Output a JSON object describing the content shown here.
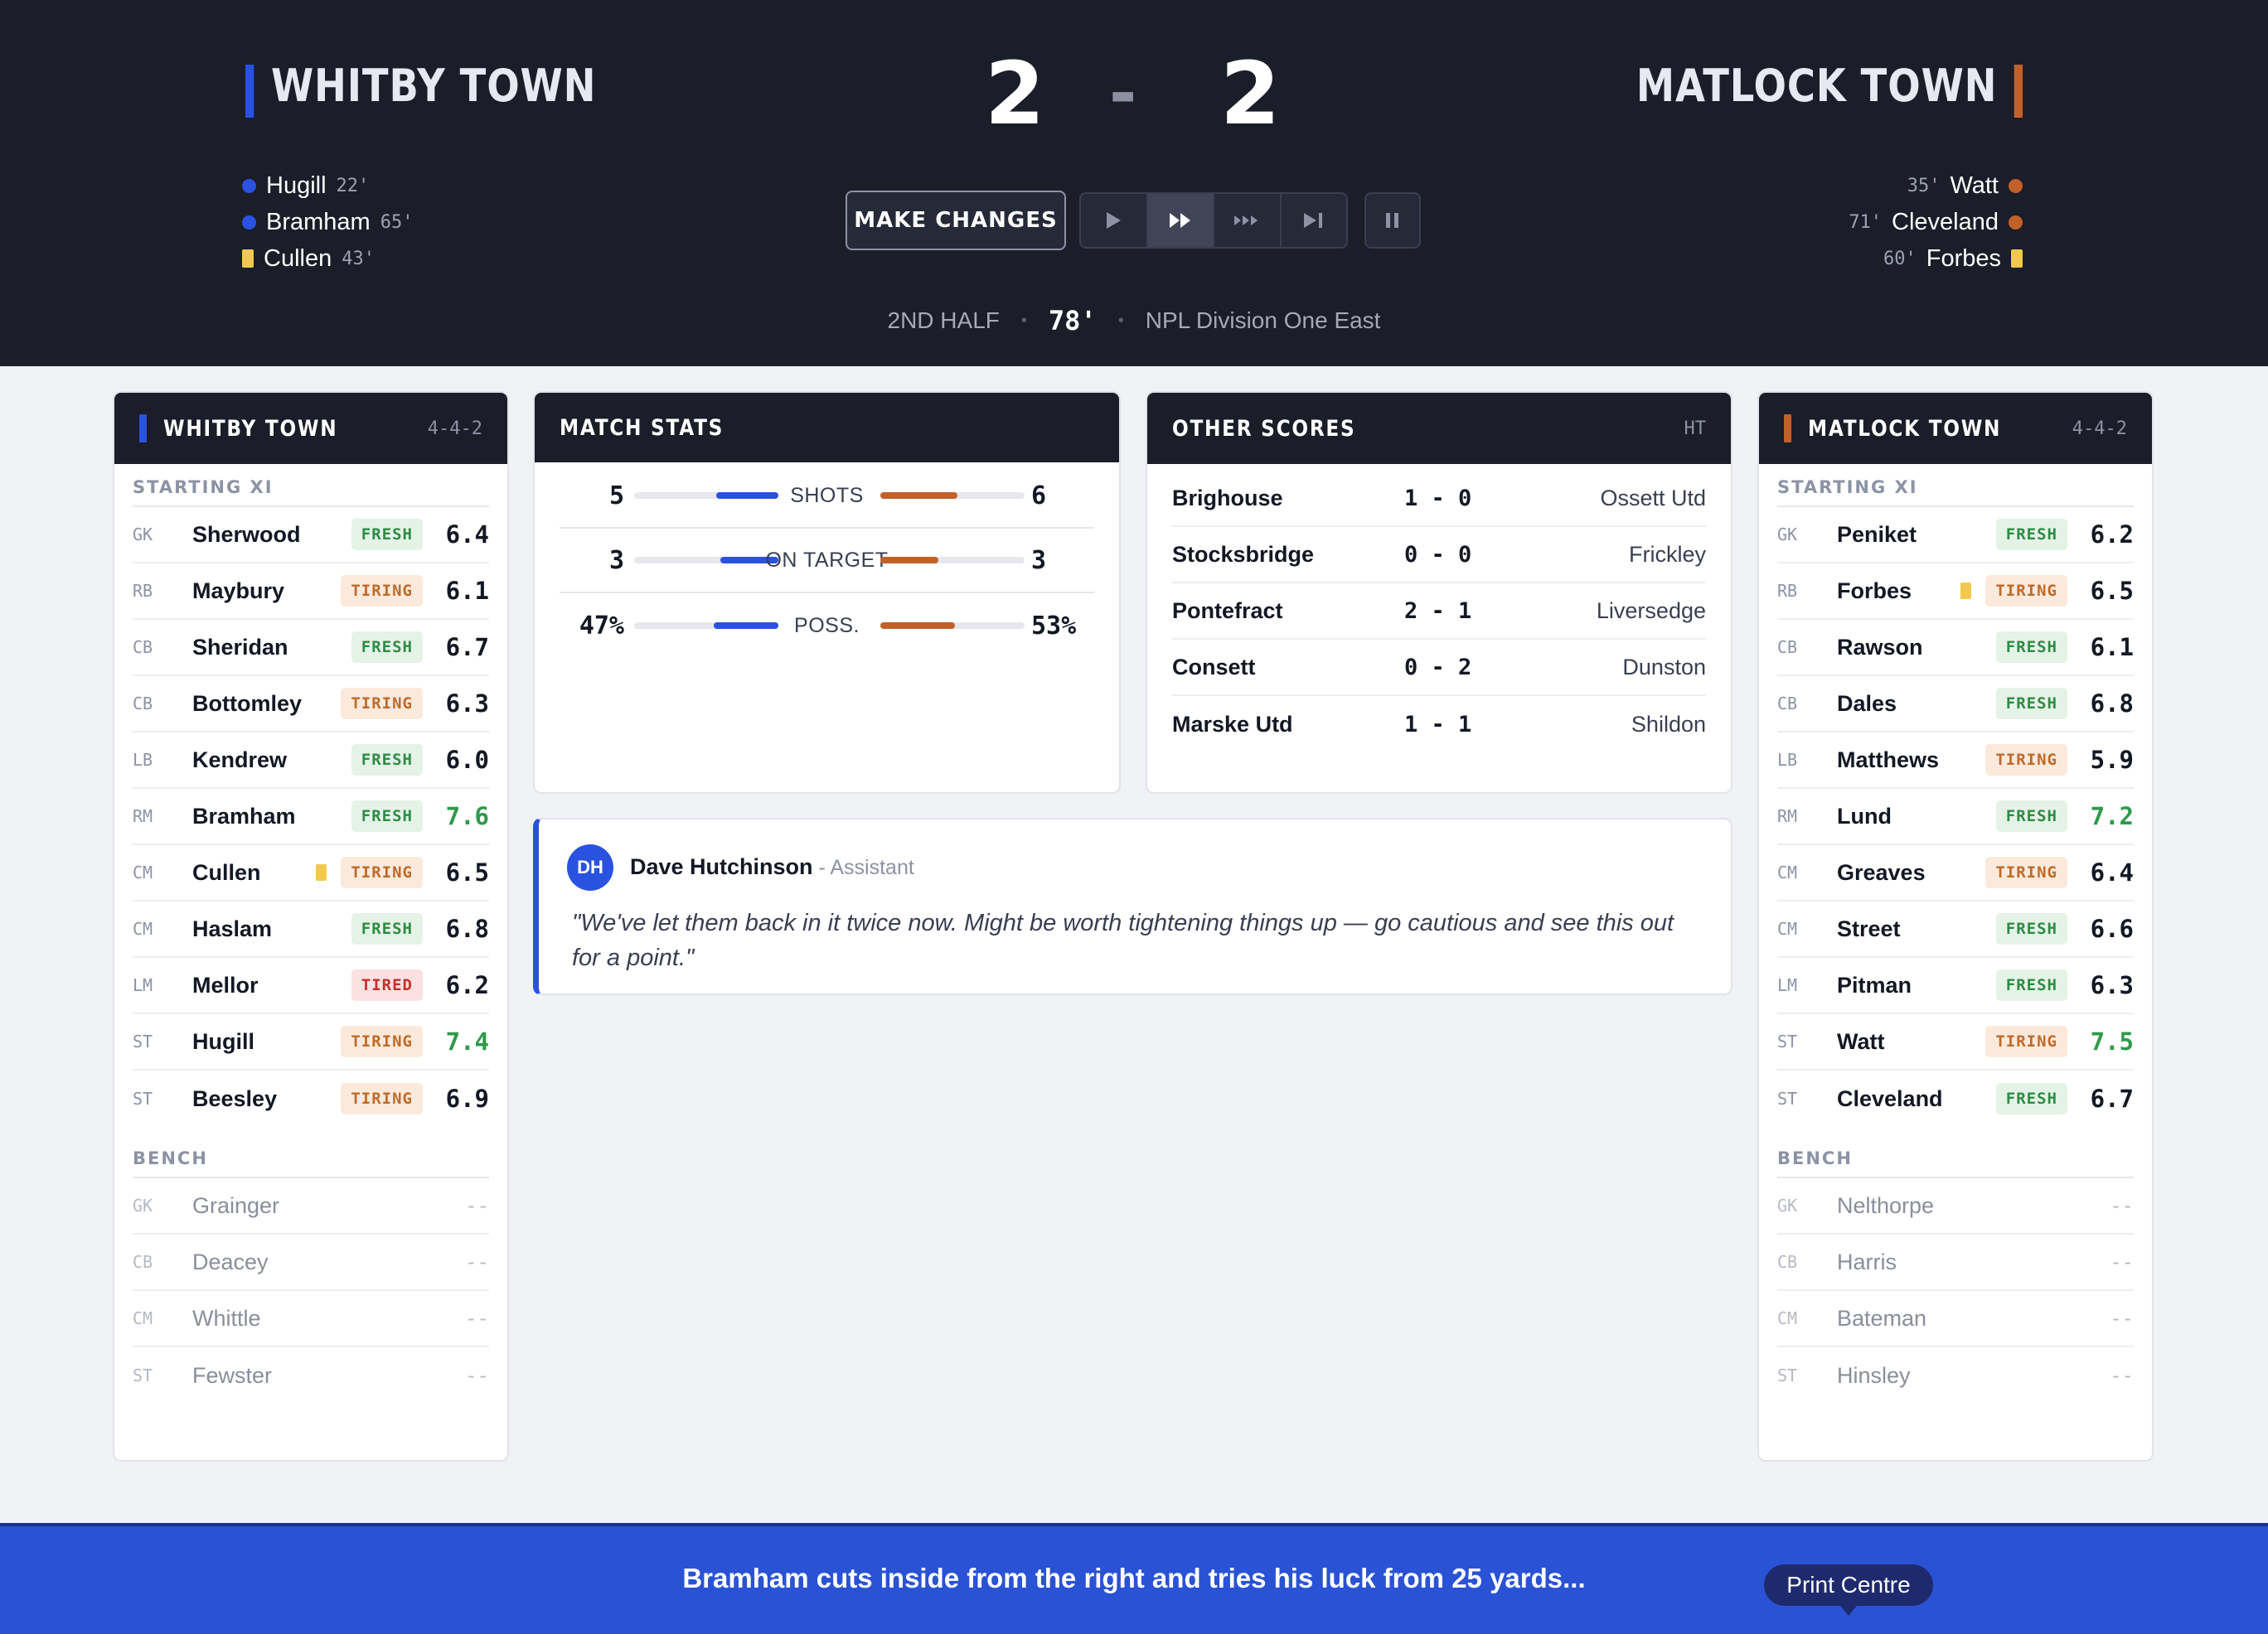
{
  "home": {
    "name": "WHITBY TOWN",
    "score": "2",
    "scorers": [
      {
        "name": "Hugill",
        "minute": "22'",
        "type": "goal"
      },
      {
        "name": "Bramham",
        "minute": "65'",
        "type": "goal"
      },
      {
        "name": "Cullen",
        "minute": "43'",
        "type": "yellow"
      }
    ]
  },
  "away": {
    "name": "MATLOCK TOWN",
    "score": "2",
    "scorers": [
      {
        "name": "Watt",
        "minute": "35'",
        "type": "goal"
      },
      {
        "name": "Cleveland",
        "minute": "71'",
        "type": "goal"
      },
      {
        "name": "Forbes",
        "minute": "60'",
        "type": "yellow"
      }
    ]
  },
  "score_separator": "-",
  "controls": {
    "make_changes": "MAKE CHANGES",
    "speed_icons": [
      "play-icon",
      "fast-forward-icon",
      "fastest-icon",
      "skip-to-end-icon"
    ],
    "active_speed": 1,
    "pause_icon": "pause-icon"
  },
  "match_meta": {
    "period": "2ND HALF",
    "clock": "78'",
    "competition": "NPL Division One East",
    "dot": "•"
  },
  "home_squad": {
    "title": "WHITBY TOWN",
    "formation": "4-4-2",
    "starting_label": "STARTING XI",
    "bench_label": "BENCH",
    "starting": [
      {
        "pos": "GK",
        "name": "Sherwood",
        "status": "FRESH",
        "rating": "6.4"
      },
      {
        "pos": "RB",
        "name": "Maybury",
        "status": "TIRING",
        "rating": "6.1"
      },
      {
        "pos": "CB",
        "name": "Sheridan",
        "status": "FRESH",
        "rating": "6.7"
      },
      {
        "pos": "CB",
        "name": "Bottomley",
        "status": "TIRING",
        "rating": "6.3"
      },
      {
        "pos": "LB",
        "name": "Kendrew",
        "status": "FRESH",
        "rating": "6.0"
      },
      {
        "pos": "RM",
        "name": "Bramham",
        "status": "FRESH",
        "rating": "7.6",
        "good": true
      },
      {
        "pos": "CM",
        "name": "Cullen",
        "status": "TIRING",
        "rating": "6.5",
        "card": "yellow"
      },
      {
        "pos": "CM",
        "name": "Haslam",
        "status": "FRESH",
        "rating": "6.8"
      },
      {
        "pos": "LM",
        "name": "Mellor",
        "status": "TIRED",
        "rating": "6.2"
      },
      {
        "pos": "ST",
        "name": "Hugill",
        "status": "TIRING",
        "rating": "7.4",
        "good": true
      },
      {
        "pos": "ST",
        "name": "Beesley",
        "status": "TIRING",
        "rating": "6.9"
      }
    ],
    "bench": [
      {
        "pos": "GK",
        "name": "Grainger",
        "rating": "--"
      },
      {
        "pos": "CB",
        "name": "Deacey",
        "rating": "--"
      },
      {
        "pos": "CM",
        "name": "Whittle",
        "rating": "--"
      },
      {
        "pos": "ST",
        "name": "Fewster",
        "rating": "--"
      }
    ]
  },
  "away_squad": {
    "title": "MATLOCK TOWN",
    "formation": "4-4-2",
    "starting_label": "STARTING XI",
    "bench_label": "BENCH",
    "starting": [
      {
        "pos": "GK",
        "name": "Peniket",
        "status": "FRESH",
        "rating": "6.2"
      },
      {
        "pos": "RB",
        "name": "Forbes",
        "status": "TIRING",
        "rating": "6.5",
        "card": "yellow"
      },
      {
        "pos": "CB",
        "name": "Rawson",
        "status": "FRESH",
        "rating": "6.1"
      },
      {
        "pos": "CB",
        "name": "Dales",
        "status": "FRESH",
        "rating": "6.8"
      },
      {
        "pos": "LB",
        "name": "Matthews",
        "status": "TIRING",
        "rating": "5.9"
      },
      {
        "pos": "RM",
        "name": "Lund",
        "status": "FRESH",
        "rating": "7.2",
        "good": true
      },
      {
        "pos": "CM",
        "name": "Greaves",
        "status": "TIRING",
        "rating": "6.4"
      },
      {
        "pos": "CM",
        "name": "Street",
        "status": "FRESH",
        "rating": "6.6"
      },
      {
        "pos": "LM",
        "name": "Pitman",
        "status": "FRESH",
        "rating": "6.3"
      },
      {
        "pos": "ST",
        "name": "Watt",
        "status": "TIRING",
        "rating": "7.5",
        "good": true
      },
      {
        "pos": "ST",
        "name": "Cleveland",
        "status": "FRESH",
        "rating": "6.7"
      }
    ],
    "bench": [
      {
        "pos": "GK",
        "name": "Nelthorpe",
        "rating": "--"
      },
      {
        "pos": "CB",
        "name": "Harris",
        "rating": "--"
      },
      {
        "pos": "CM",
        "name": "Bateman",
        "rating": "--"
      },
      {
        "pos": "ST",
        "name": "Hinsley",
        "rating": "--"
      }
    ]
  },
  "match_stats": {
    "title": "MATCH STATS",
    "rows": [
      {
        "label": "SHOTS",
        "home": "5",
        "away": "6",
        "home_share": 0.26,
        "away_share": 0.32
      },
      {
        "label": "ON TARGET",
        "home": "3",
        "away": "3",
        "home_share": 0.24,
        "away_share": 0.24
      },
      {
        "label": "POSS.",
        "home": "47%",
        "away": "53%",
        "home_share": 0.27,
        "away_share": 0.31
      }
    ]
  },
  "other_scores": {
    "title": "OTHER SCORES",
    "status": "HT",
    "rows": [
      {
        "home": "Brighouse",
        "score": "1 - 0",
        "away": "Ossett Utd"
      },
      {
        "home": "Stocksbridge",
        "score": "0 - 0",
        "away": "Frickley"
      },
      {
        "home": "Pontefract",
        "score": "2 - 1",
        "away": "Liversedge"
      },
      {
        "home": "Consett",
        "score": "0 - 2",
        "away": "Dunston"
      },
      {
        "home": "Marske Utd",
        "score": "1 - 1",
        "away": "Shildon"
      }
    ]
  },
  "assistant": {
    "initials": "DH",
    "name": "Dave Hutchinson",
    "role": " - Assistant",
    "quote": "\"We've let them back in it twice now. Might be worth tightening things up — go cautious and see this out for a point.\""
  },
  "ticker": {
    "text": "Bramham cuts inside from the right and tries his luck from 25 yards..."
  },
  "tooltip": {
    "text": "Print Centre"
  },
  "colors": {
    "home": "#2a52e0",
    "away": "#c2602a",
    "header_bg": "#1b1d28",
    "ticker_bg": "#2a52d4",
    "yellow_card": "#f2c94c"
  }
}
